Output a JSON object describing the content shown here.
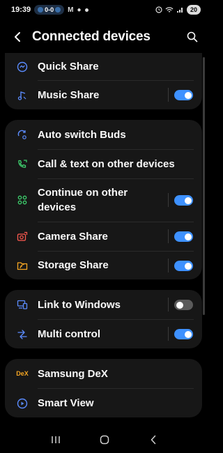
{
  "status_bar": {
    "time": "19:39",
    "score": "0-0",
    "battery": "20"
  },
  "header": {
    "title": "Connected devices"
  },
  "sections": [
    {
      "items": [
        {
          "label": "Quick Share",
          "icon": "quick-share-icon"
        },
        {
          "label": "Music Share",
          "icon": "music-share-icon",
          "toggle": true
        }
      ]
    },
    {
      "items": [
        {
          "label": "Auto switch Buds",
          "icon": "auto-switch-buds-icon"
        },
        {
          "label": "Call & text on other devices",
          "icon": "call-text-icon"
        },
        {
          "label": "Continue on other devices",
          "icon": "continue-apps-icon",
          "toggle": true
        },
        {
          "label": "Camera Share",
          "icon": "camera-share-icon",
          "toggle": true
        },
        {
          "label": "Storage Share",
          "icon": "storage-share-icon",
          "toggle": true
        }
      ]
    },
    {
      "items": [
        {
          "label": "Link to Windows",
          "icon": "link-to-windows-icon",
          "toggle": false
        },
        {
          "label": "Multi control",
          "icon": "multi-control-icon",
          "toggle": true
        }
      ]
    },
    {
      "items": [
        {
          "label": "Samsung DeX",
          "icon": "samsung-dex-icon",
          "icon_text": "DeX"
        },
        {
          "label": "Smart View",
          "icon": "smart-view-icon"
        }
      ]
    }
  ],
  "colors": {
    "background": "#000000",
    "card": "#171717",
    "toggle_on": "#3e91ff",
    "toggle_off": "#5a5a5a",
    "icon_blue": "#5b8cff",
    "icon_green": "#3ecf6e",
    "icon_red": "#ff5a4f",
    "icon_orange": "#f5a623"
  }
}
